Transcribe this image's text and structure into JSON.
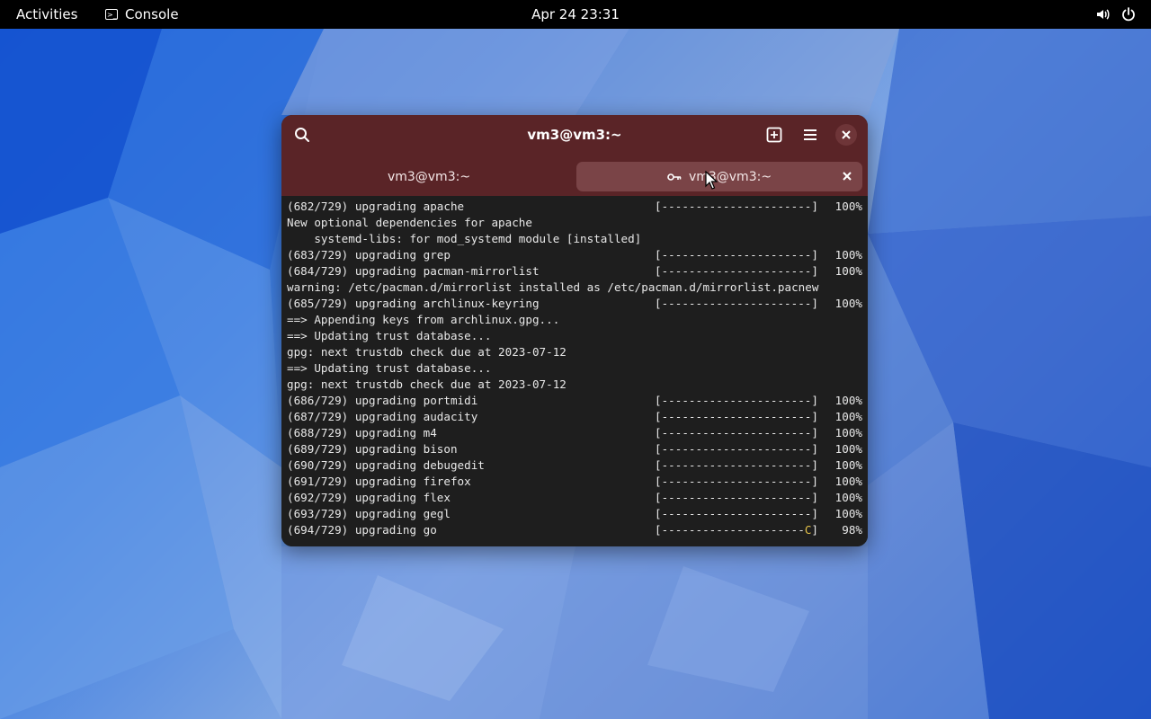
{
  "topbar": {
    "activities": "Activities",
    "app_name": "Console",
    "clock": "Apr 24  23:31",
    "icons": [
      "volume-icon",
      "power-icon"
    ]
  },
  "window": {
    "title": "vm3@vm3:~",
    "tabs": [
      {
        "label": "vm3@vm3:~",
        "active": false
      },
      {
        "label": "vm3@vm3:~",
        "active": true,
        "icon": "key-icon"
      }
    ]
  },
  "terminal": {
    "lines": [
      {
        "text": "(682/729) upgrading apache",
        "bar": "[----------------------]",
        "pct": "100%"
      },
      {
        "text": "New optional dependencies for apache"
      },
      {
        "text": "    systemd-libs: for mod_systemd module [installed]"
      },
      {
        "text": "(683/729) upgrading grep",
        "bar": "[----------------------]",
        "pct": "100%"
      },
      {
        "text": "(684/729) upgrading pacman-mirrorlist",
        "bar": "[----------------------]",
        "pct": "100%"
      },
      {
        "text": "warning: /etc/pacman.d/mirrorlist installed as /etc/pacman.d/mirrorlist.pacnew"
      },
      {
        "text": "(685/729) upgrading archlinux-keyring",
        "bar": "[----------------------]",
        "pct": "100%"
      },
      {
        "text": "==> Appending keys from archlinux.gpg..."
      },
      {
        "text": "==> Updating trust database..."
      },
      {
        "text": "gpg: next trustdb check due at 2023-07-12"
      },
      {
        "text": "==> Updating trust database..."
      },
      {
        "text": "gpg: next trustdb check due at 2023-07-12"
      },
      {
        "text": "(686/729) upgrading portmidi",
        "bar": "[----------------------]",
        "pct": "100%"
      },
      {
        "text": "(687/729) upgrading audacity",
        "bar": "[----------------------]",
        "pct": "100%"
      },
      {
        "text": "(688/729) upgrading m4",
        "bar": "[----------------------]",
        "pct": "100%"
      },
      {
        "text": "(689/729) upgrading bison",
        "bar": "[----------------------]",
        "pct": "100%"
      },
      {
        "text": "(690/729) upgrading debugedit",
        "bar": "[----------------------]",
        "pct": "100%"
      },
      {
        "text": "(691/729) upgrading firefox",
        "bar": "[----------------------]",
        "pct": "100%"
      },
      {
        "text": "(692/729) upgrading flex",
        "bar": "[----------------------]",
        "pct": "100%"
      },
      {
        "text": "(693/729) upgrading gegl",
        "bar": "[----------------------]",
        "pct": "100%"
      },
      {
        "text": "(694/729) upgrading go",
        "bar": "[---------------------",
        "bar_cursor": "C",
        "bar_end": "]",
        "pct": "98%"
      }
    ]
  },
  "colors": {
    "headerbar": "#5a2427",
    "active_tab": "#7a4447",
    "terminal_bg": "#1e1e1e",
    "pacman_cursor": "#e5c34a"
  }
}
